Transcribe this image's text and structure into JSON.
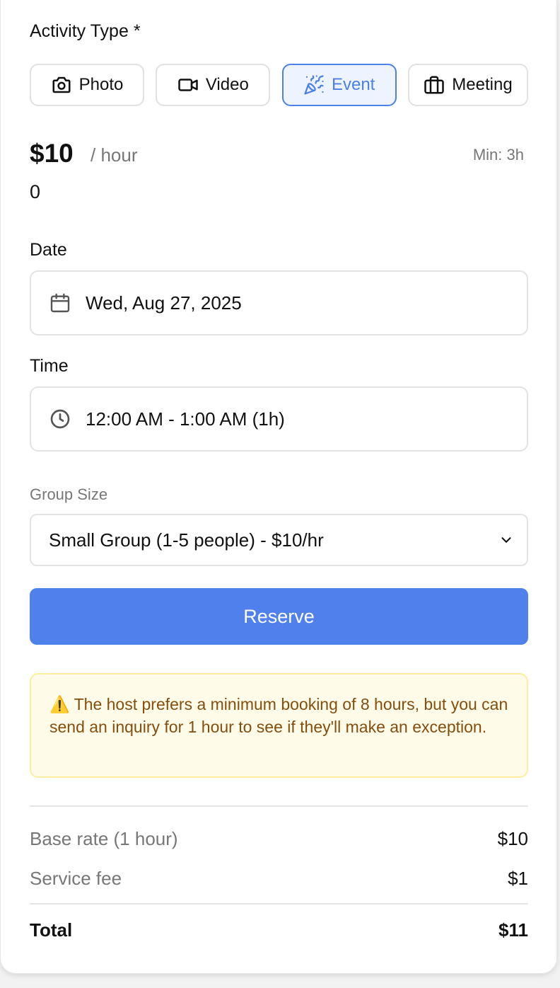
{
  "activity": {
    "label": "Activity Type *",
    "options": [
      {
        "label": "Photo",
        "icon": "camera-icon"
      },
      {
        "label": "Video",
        "icon": "video-icon"
      },
      {
        "label": "Event",
        "icon": "party-popper-icon",
        "selected": true
      },
      {
        "label": "Meeting",
        "icon": "briefcase-icon"
      }
    ]
  },
  "pricing": {
    "price": "$10",
    "unit": "/ hour",
    "min": "Min: 3h",
    "extra": "0"
  },
  "date": {
    "label": "Date",
    "value": "Wed, Aug 27, 2025",
    "icon": "calendar-icon"
  },
  "time": {
    "label": "Time",
    "value": "12:00 AM - 1:00 AM (1h)",
    "icon": "clock-icon"
  },
  "group": {
    "label": "Group Size",
    "selected": "Small Group (1-5 people) - $10/hr"
  },
  "reserve_label": "Reserve",
  "warning": {
    "text": "⚠️ The host prefers a minimum booking of 8 hours, but you can send an inquiry for 1 hour to see if they'll make an exception."
  },
  "summary": {
    "base_label": "Base rate (1 hour)",
    "base_value": "$10",
    "fee_label": "Service fee",
    "fee_value": "$1",
    "total_label": "Total",
    "total_value": "$11"
  },
  "colors": {
    "accent": "#4f80eb",
    "warning_bg": "#fefce8",
    "warning_border": "#fbef9e",
    "warning_text": "#854d0e"
  }
}
